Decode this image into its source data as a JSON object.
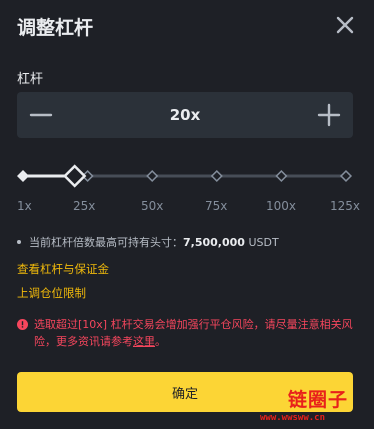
{
  "header": {
    "title": "调整杠杆"
  },
  "stepper": {
    "label": "杠杆",
    "value": "20x"
  },
  "slider": {
    "ticks": [
      "1x",
      "25x",
      "50x",
      "75x",
      "100x",
      "125x"
    ],
    "current_position": 0.16
  },
  "info": {
    "max_position_label": "当前杠杆倍数最高可持有头寸：",
    "max_position_value": "7,500,000",
    "max_position_unit": "USDT"
  },
  "links": {
    "view_leverage": "查看杠杆与保证金",
    "adjust_limit": "上调仓位限制"
  },
  "warning": {
    "text": "选取超过[10x] 杠杆交易会增加强行平仓风险，请尽量注意相关风险，更多资讯请参考",
    "link": "这里",
    "end": "。"
  },
  "footer": {
    "confirm_label": "确定"
  },
  "watermark": {
    "main": "链圈子",
    "url": "www.wwsww.cn"
  },
  "colors": {
    "background": "#1e2026",
    "accent": "#fcd535",
    "link": "#f0b90b",
    "warning": "#f6465d",
    "muted": "#848e9c"
  }
}
